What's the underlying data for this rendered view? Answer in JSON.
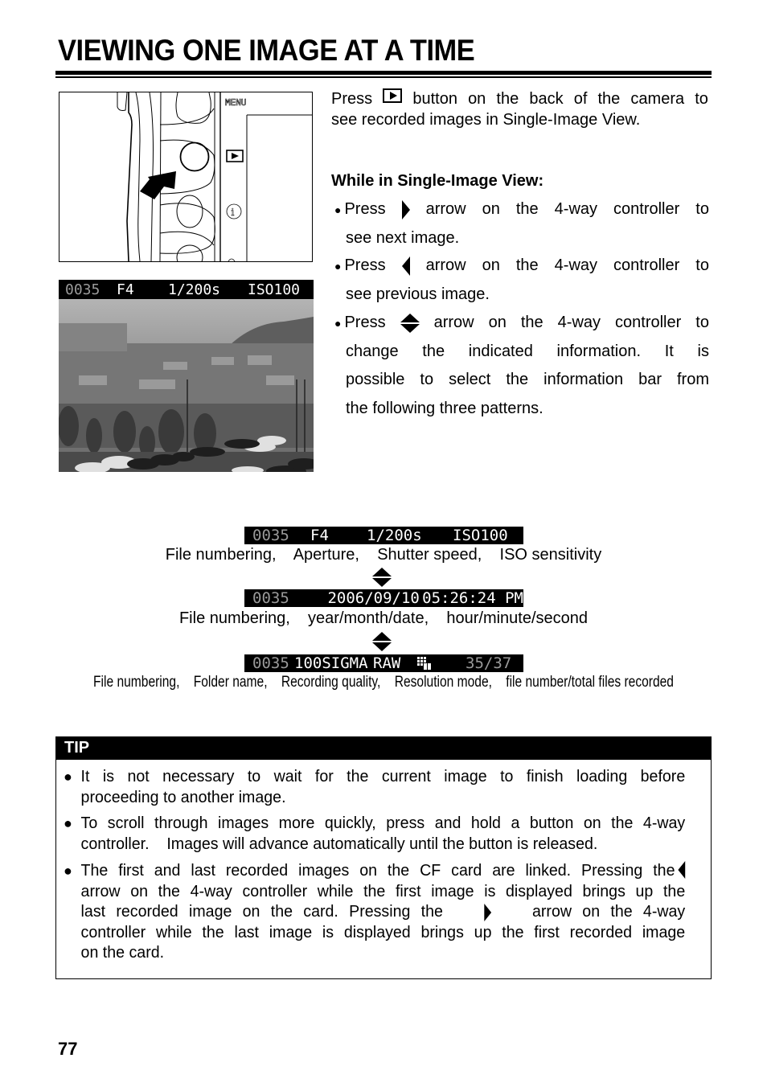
{
  "page": {
    "title": "VIEWING ONE IMAGE AT A TIME",
    "page_number": "77"
  },
  "camera_illustration": {
    "menu_label": "MENU",
    "play_icon": "play-button-icon",
    "info_icon": "info-icon",
    "pointer_icon": "pointing-arrow-icon"
  },
  "sample_photo": {
    "osd": {
      "file_number": "0035",
      "aperture": "F4",
      "shutter": "1/200s",
      "iso": "ISO100"
    },
    "scene": "grayscale landscape with houses, trees and parked cars"
  },
  "intro": {
    "line1_before_icon": "Press",
    "line1_icon": "play-button-icon",
    "line1_after_icon": [
      "button",
      "on",
      "the",
      "back",
      "of",
      "the",
      "camera",
      "to"
    ],
    "line2": "see recorded images in Single-Image View."
  },
  "subheading": "While in Single-Image View:",
  "bullets": [
    {
      "icon": "right-arrow-icon",
      "prefix": "Press",
      "line1_rest": [
        "arrow",
        "on",
        "the",
        "4-way",
        "controller",
        "to"
      ],
      "continuation": [
        "see next image."
      ]
    },
    {
      "icon": "left-arrow-icon",
      "prefix": "Press",
      "line1_rest": [
        "arrow",
        "on",
        "the",
        "4-way",
        "controller",
        "to"
      ],
      "continuation": [
        "see previous image."
      ]
    },
    {
      "icon": "up-down-arrow-icon",
      "prefix": "Press",
      "line1_rest": [
        "arrow",
        "on",
        "the",
        "4-way",
        "controller",
        "to"
      ],
      "continuation": [
        "change the indicated information.  It is",
        "possible to select the information bar from",
        "the following three patterns."
      ]
    }
  ],
  "patterns": [
    {
      "bar": {
        "file_number": "0035",
        "f1": "F4",
        "f2": "1/200s",
        "f3": "ISO100"
      },
      "caption": "File numbering,    Aperture,    Shutter speed,    ISO sensitivity"
    },
    {
      "bar": {
        "file_number": "0035",
        "f1": "2006/09/10",
        "f2": "05:26:24 PM"
      },
      "caption": "File numbering,    year/month/date,    hour/minute/second"
    },
    {
      "bar": {
        "file_number": "0035",
        "f1": "100SIGMA",
        "f2": "RAW",
        "resolution_icon": "resolution-mode-icon",
        "f3": "35/37"
      },
      "caption": "File numbering,    Folder name,    Recording quality,    Resolution mode,    file number/total files recorded"
    }
  ],
  "tip": {
    "header": "TIP",
    "items": [
      {
        "lines": [
          "It is not necessary to wait for the current image to finish loading before",
          "proceeding to another image."
        ]
      },
      {
        "lines": [
          "To scroll through images more quickly, press and hold a button on the 4-way",
          "controller.    Images will advance automatically until the button is released."
        ]
      },
      {
        "line1": "The first and last recorded images on the CF card are linked. Pressing the",
        "line1_icon": "left-arrow-icon",
        "line2": "arrow on the 4-way controller while the first image is displayed brings up the",
        "line3_before": "last recorded image on the card. Pressing the",
        "line3_icon": "right-arrow-icon",
        "line3_after": "arrow on the 4-way",
        "line4": "controller while the last image is displayed brings up the first recorded image",
        "line5": "on the card."
      }
    ]
  },
  "colors": {
    "ink": "#000000",
    "paper": "#ffffff",
    "osd_dim": "#9a9a9a"
  }
}
